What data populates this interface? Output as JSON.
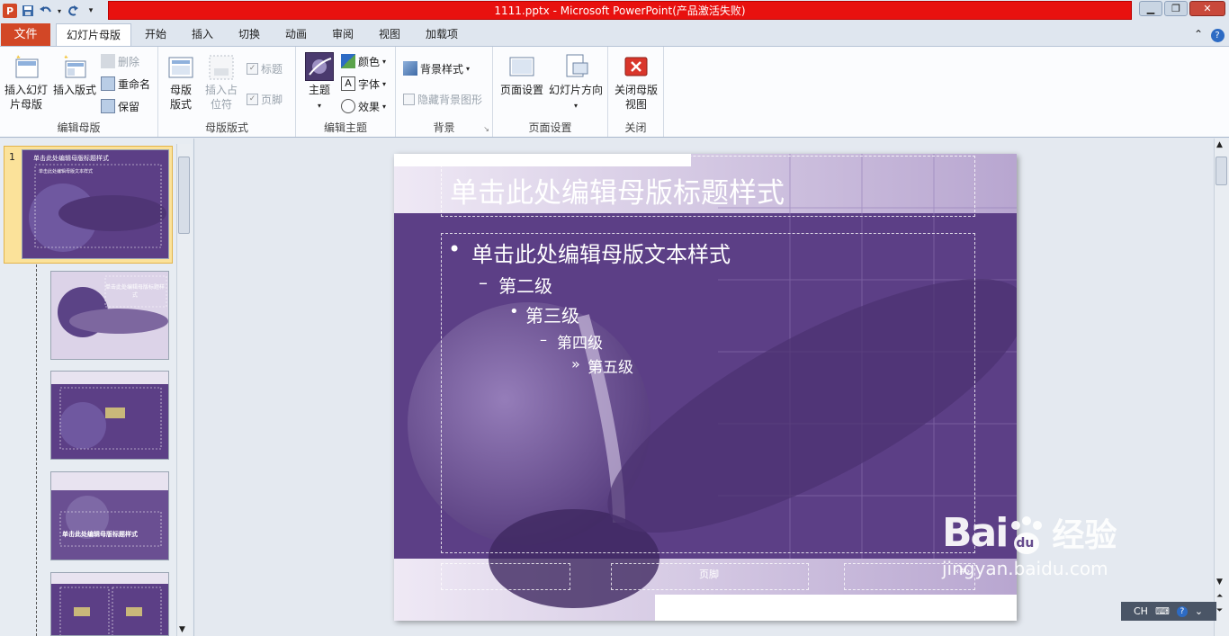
{
  "window": {
    "title": "1111.pptx  -  Microsoft PowerPoint(产品激活失败)",
    "app_icon": "P"
  },
  "qat": {
    "icons": [
      "save-icon",
      "undo-icon",
      "redo-icon",
      "customize-icon"
    ]
  },
  "tabs": {
    "file": "文件",
    "items": [
      "幻灯片母版",
      "开始",
      "插入",
      "切换",
      "动画",
      "审阅",
      "视图",
      "加载项"
    ],
    "active": "幻灯片母版"
  },
  "ribbon": {
    "edit_master": {
      "label": "编辑母版",
      "insert_slide_master": "插入幻灯片母版",
      "insert_layout": "插入版式",
      "delete": "删除",
      "rename": "重命名",
      "preserve": "保留"
    },
    "master_layout": {
      "label": "母版版式",
      "master_layout": "母版版式",
      "insert_placeholder": "插入占位符",
      "title": "标题",
      "footer": "页脚"
    },
    "edit_theme": {
      "label": "编辑主题",
      "themes": "主题",
      "colors": "颜色",
      "fonts": "字体",
      "effects": "效果"
    },
    "background": {
      "label": "背景",
      "bg_styles": "背景样式",
      "hide_bg": "隐藏背景图形"
    },
    "page_setup": {
      "label": "页面设置",
      "page_setup": "页面设置",
      "orientation": "幻灯片方向"
    },
    "close": {
      "label": "关闭",
      "close_master": "关闭母版视图"
    }
  },
  "thumbnails": {
    "selected_number": "1",
    "thumb1_title": "单击此处编辑母版标题样式",
    "thumb1_body": "单击此处编辑母版文本样式",
    "thumb2_title": "单击此处编辑母版标题样式",
    "thumb4_title": "单击此处编辑母版标题样式"
  },
  "slide": {
    "title": "单击此处编辑母版标题样式",
    "levels": [
      "单击此处编辑母版文本样式",
      "第二级",
      "第三级",
      "第四级",
      "第五级"
    ],
    "bullets": [
      "•",
      "–",
      "•",
      "–",
      "»"
    ],
    "footer": "页脚",
    "slide_number": "‹#›"
  },
  "status": {
    "ime": "CH"
  },
  "watermark": {
    "brand": "Bai",
    "paw": "du",
    "cn": "经验",
    "url": "jingyan.baidu.com"
  },
  "colors": {
    "title_red": "#e8110f",
    "file_tab": "#d24726",
    "slide_purple": "#5b3f83"
  }
}
